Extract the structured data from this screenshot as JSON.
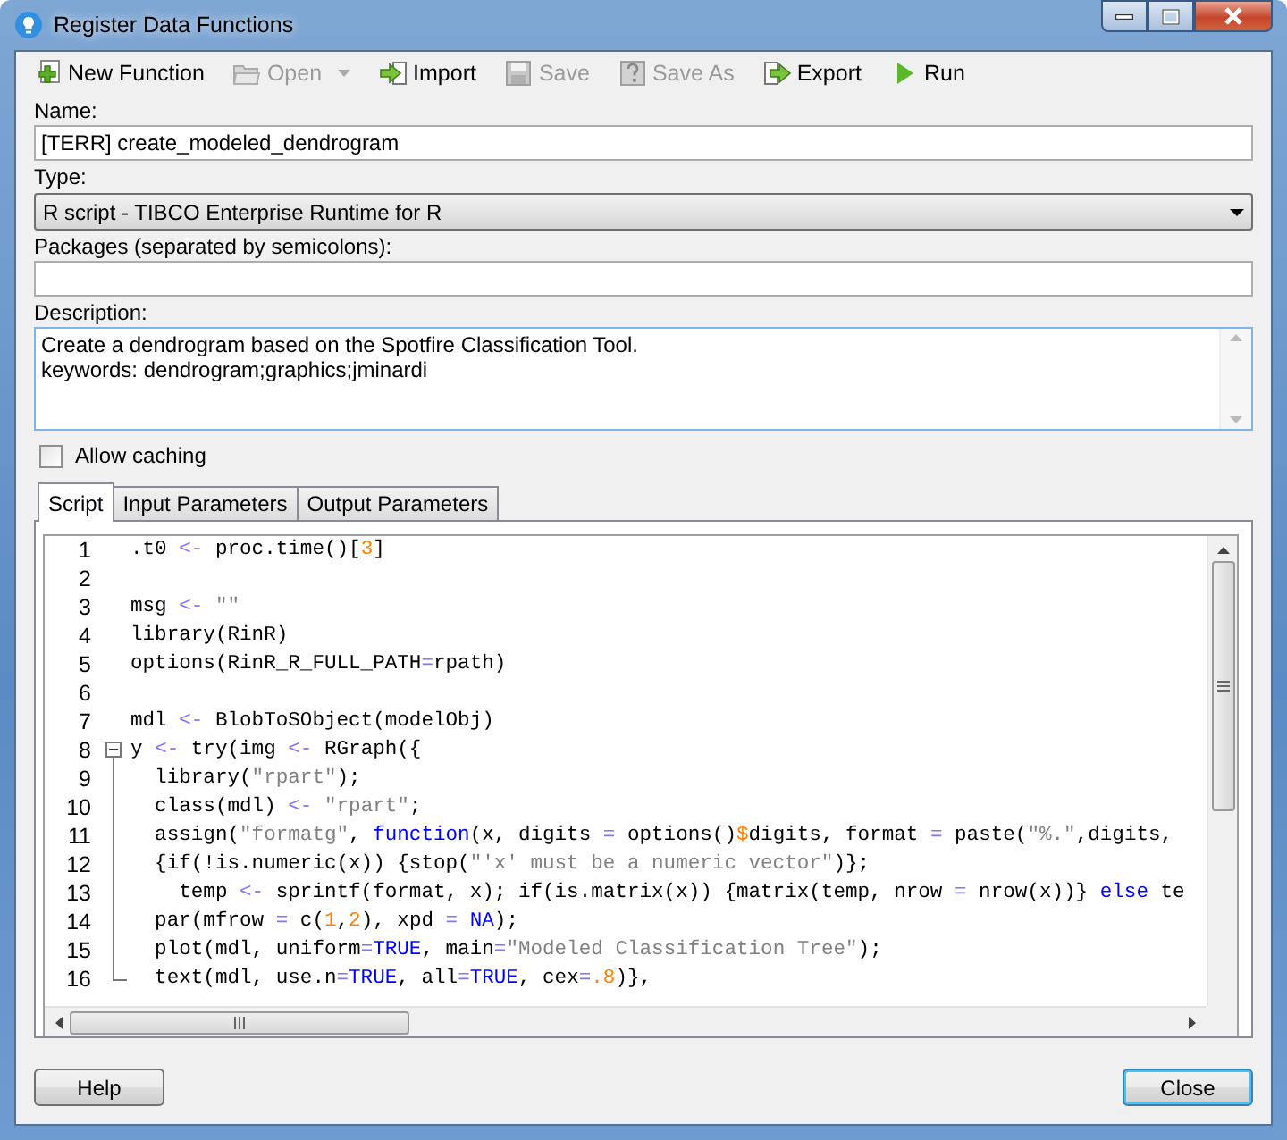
{
  "window": {
    "title": "Register Data Functions"
  },
  "toolbar": [
    {
      "kind": "new",
      "label": "New Function",
      "disabled": false
    },
    {
      "kind": "open",
      "label": "Open",
      "disabled": true,
      "menu": true
    },
    {
      "kind": "import",
      "label": "Import",
      "disabled": false
    },
    {
      "kind": "save",
      "label": "Save",
      "disabled": true
    },
    {
      "kind": "saveas",
      "label": "Save As",
      "disabled": true
    },
    {
      "kind": "export",
      "label": "Export",
      "disabled": false
    },
    {
      "kind": "run",
      "label": "Run",
      "disabled": false
    }
  ],
  "name": {
    "label": "Name:",
    "value": "[TERR] create_modeled_dendrogram"
  },
  "type": {
    "label": "Type:",
    "value": "R script - TIBCO Enterprise Runtime for R"
  },
  "packages": {
    "label": "Packages (separated by semicolons):"
  },
  "description": {
    "label": "Description:",
    "lines": [
      "Create a dendrogram based on the Spotfire Classification Tool.",
      "keywords: dendrogram;graphics;jminardi"
    ]
  },
  "allow_caching": {
    "label": "Allow caching",
    "checked": false
  },
  "tabs": [
    {
      "label": "Script",
      "selected": true
    },
    {
      "label": "Input Parameters",
      "selected": false
    },
    {
      "label": "Output Parameters",
      "selected": false
    }
  ],
  "script_lines": [
    {
      "number": "1",
      "tokens": [
        {
          "kind": "text",
          "text": ".t0 "
        },
        {
          "kind": "op",
          "text": "<-"
        },
        {
          "kind": "text",
          "text": " proc.time()["
        },
        {
          "kind": "num",
          "text": "3"
        },
        {
          "kind": "text",
          "text": "]"
        }
      ]
    },
    {
      "number": "2"
    },
    {
      "number": "3",
      "tokens": [
        {
          "kind": "text",
          "text": "msg "
        },
        {
          "kind": "op",
          "text": "<-"
        },
        {
          "kind": "str",
          "text": " \"\""
        }
      ]
    },
    {
      "number": "4",
      "tokens": [
        {
          "kind": "text",
          "text": "library(RinR)"
        }
      ]
    },
    {
      "number": "5",
      "tokens": [
        {
          "kind": "text",
          "text": "options(RinR_R_FULL_PATH"
        },
        {
          "kind": "op",
          "text": "="
        },
        {
          "kind": "text",
          "text": "rpath)"
        }
      ]
    },
    {
      "number": "6"
    },
    {
      "number": "7",
      "tokens": [
        {
          "kind": "text",
          "text": "mdl "
        },
        {
          "kind": "op",
          "text": "<-"
        },
        {
          "kind": "text",
          "text": " BlobToSObject(modelObj)"
        }
      ]
    },
    {
      "number": "8",
      "kind": "fold_start",
      "tokens": [
        {
          "kind": "text",
          "text": "y "
        },
        {
          "kind": "op",
          "text": "<-"
        },
        {
          "kind": "text",
          "text": " try(img "
        },
        {
          "kind": "op",
          "text": "<-"
        },
        {
          "kind": "text",
          "text": " RGraph({"
        }
      ]
    },
    {
      "number": "9",
      "kind": "fold_body",
      "tokens": [
        {
          "kind": "text",
          "text": "  library("
        },
        {
          "kind": "str",
          "text": "\"rpart\""
        },
        {
          "kind": "text",
          "text": ");"
        }
      ]
    },
    {
      "number": "10",
      "kind": "fold_body",
      "tokens": [
        {
          "kind": "text",
          "text": "  class(mdl) "
        },
        {
          "kind": "op",
          "text": "<-"
        },
        {
          "kind": "str",
          "text": " \"rpart\""
        },
        {
          "kind": "text",
          "text": ";"
        }
      ]
    },
    {
      "number": "11",
      "kind": "fold_body",
      "tokens": [
        {
          "kind": "text",
          "text": "  assign("
        },
        {
          "kind": "str",
          "text": "\"formatg\""
        },
        {
          "kind": "text",
          "text": ", "
        },
        {
          "kind": "kw",
          "text": "function"
        },
        {
          "kind": "text",
          "text": "(x, digits "
        },
        {
          "kind": "op",
          "text": "="
        },
        {
          "kind": "text",
          "text": " options()"
        },
        {
          "kind": "num",
          "text": "$"
        },
        {
          "kind": "text",
          "text": "digits, format "
        },
        {
          "kind": "op",
          "text": "="
        },
        {
          "kind": "text",
          "text": " paste("
        },
        {
          "kind": "str",
          "text": "\"%.\""
        },
        {
          "kind": "text",
          "text": ",digits,"
        }
      ]
    },
    {
      "number": "12",
      "kind": "fold_body",
      "tokens": [
        {
          "kind": "text",
          "text": "  {if(!is.numeric(x)) {stop("
        },
        {
          "kind": "str",
          "text": "\"'x' must be a numeric vector\""
        },
        {
          "kind": "text",
          "text": ")};"
        }
      ]
    },
    {
      "number": "13",
      "kind": "fold_body",
      "tokens": [
        {
          "kind": "text",
          "text": "    temp "
        },
        {
          "kind": "op",
          "text": "<-"
        },
        {
          "kind": "text",
          "text": " sprintf(format, x); if(is.matrix(x)) {matrix(temp, nrow "
        },
        {
          "kind": "op",
          "text": "="
        },
        {
          "kind": "text",
          "text": " nrow(x))} "
        },
        {
          "kind": "kw",
          "text": "else"
        },
        {
          "kind": "text",
          "text": " te"
        }
      ]
    },
    {
      "number": "14",
      "kind": "fold_body",
      "tokens": [
        {
          "kind": "text",
          "text": "  par(mfrow "
        },
        {
          "kind": "op",
          "text": "="
        },
        {
          "kind": "text",
          "text": " c("
        },
        {
          "kind": "num",
          "text": "1"
        },
        {
          "kind": "text",
          "text": ","
        },
        {
          "kind": "num",
          "text": "2"
        },
        {
          "kind": "text",
          "text": "), xpd "
        },
        {
          "kind": "op",
          "text": "="
        },
        {
          "kind": "kw",
          "text": " NA"
        },
        {
          "kind": "text",
          "text": ");"
        }
      ]
    },
    {
      "number": "15",
      "kind": "fold_body",
      "tokens": [
        {
          "kind": "text",
          "text": "  plot(mdl, uniform"
        },
        {
          "kind": "op",
          "text": "="
        },
        {
          "kind": "kw",
          "text": "TRUE"
        },
        {
          "kind": "text",
          "text": ", main"
        },
        {
          "kind": "op",
          "text": "="
        },
        {
          "kind": "str",
          "text": "\"Modeled Classification Tree\""
        },
        {
          "kind": "text",
          "text": ");"
        }
      ]
    },
    {
      "number": "16",
      "kind": "fold_end",
      "tokens": [
        {
          "kind": "text",
          "text": "  text(mdl, use.n"
        },
        {
          "kind": "op",
          "text": "="
        },
        {
          "kind": "kw",
          "text": "TRUE"
        },
        {
          "kind": "text",
          "text": ", all"
        },
        {
          "kind": "op",
          "text": "="
        },
        {
          "kind": "kw",
          "text": "TRUE"
        },
        {
          "kind": "text",
          "text": ", cex"
        },
        {
          "kind": "op",
          "text": "="
        },
        {
          "kind": "num",
          "text": ".8"
        },
        {
          "kind": "text",
          "text": ")},"
        }
      ]
    }
  ],
  "buttons": [
    {
      "label": "Help",
      "default": false
    },
    {
      "label": "Close",
      "default": true
    }
  ]
}
